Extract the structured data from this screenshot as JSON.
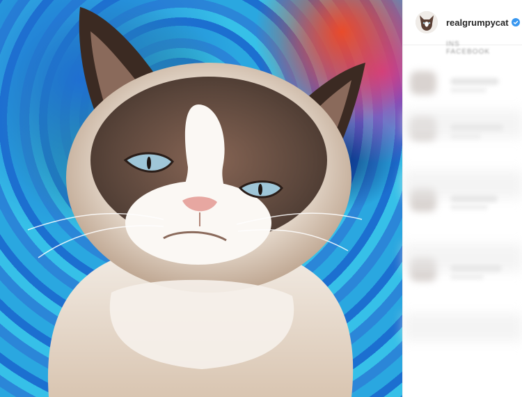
{
  "post": {
    "image_alt": "",
    "account": {
      "username": "realgrumpycat",
      "verified": true,
      "verified_color": "#3897f0",
      "avatar_icon": "cat-avatar"
    },
    "meta_blurred": [
      "INS",
      "FACEBOOK"
    ],
    "comments_count_visible": 5
  },
  "colors": {
    "sidebar_bg": "#ffffff",
    "divider": "#efefef",
    "username": "#262626"
  }
}
